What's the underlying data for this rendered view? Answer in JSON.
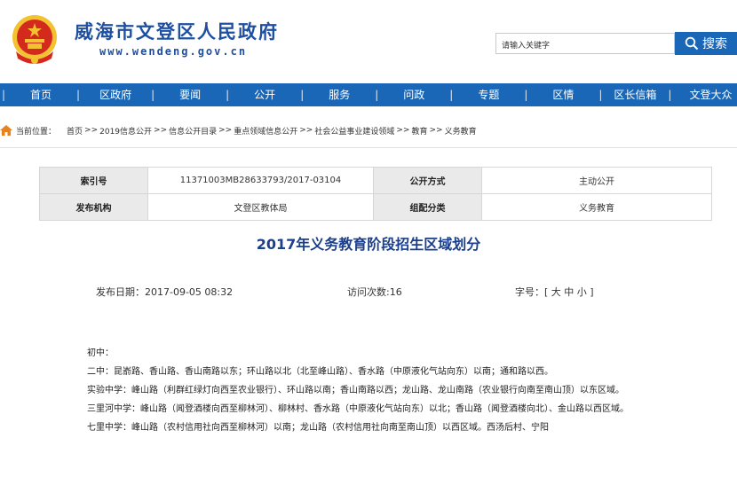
{
  "header": {
    "site_title": "威海市文登区人民政府",
    "site_url": "www.wendeng.gov.cn",
    "search_placeholder": "请输入关键字",
    "search_button": "搜索"
  },
  "colors": {
    "brand_blue": "#1a67b8",
    "title_blue": "#1a3f8c",
    "emblem_red": "#d42a1e",
    "emblem_gold": "#f2c230"
  },
  "nav": {
    "items": [
      "首页",
      "区政府",
      "要闻",
      "公开",
      "服务",
      "问政",
      "专题",
      "区情",
      "区长信箱",
      "文登大众"
    ]
  },
  "breadcrumb": {
    "label": "当前位置：",
    "items": [
      "首页",
      "2019信息公开",
      "信息公开目录",
      "重点领域信息公开",
      "社会公益事业建设领域",
      "教育",
      "义务教育"
    ],
    "separator": ">>"
  },
  "meta": {
    "index_label": "索引号",
    "index_value": "11371003MB28633793/2017-03104",
    "open_label": "公开方式",
    "open_value": "主动公开",
    "publisher_label": "发布机构",
    "publisher_value": "文登区教体局",
    "category_label": "组配分类",
    "category_value": "义务教育"
  },
  "article": {
    "title": "2017年义务教育阶段招生区域划分",
    "publish_date": "发布日期：2017-09-05 08:32",
    "visits": "访问次数:16",
    "font_size": "字号：[ 大 中 小 ]",
    "paragraphs": [
      "初中：",
      "二中：昆嵛路、香山路、香山南路以东；环山路以北（北至峰山路）、香水路（中原液化气站向东）以南；通和路以西。",
      "实验中学：峰山路（利群红绿灯向西至农业银行）、环山路以南；香山南路以西；龙山路、龙山南路（农业银行向南至南山顶）以东区域。",
      "三里河中学：峰山路（闻登酒楼向西至柳林河）、柳林村、香水路（中原液化气站向东）以北；香山路（闻登酒楼向北）、金山路以西区域。",
      "七里中学：峰山路（农村信用社向西至柳林河）以南；龙山路（农村信用社向南至南山顶）以西区域。西汤后村、宁阳"
    ]
  }
}
